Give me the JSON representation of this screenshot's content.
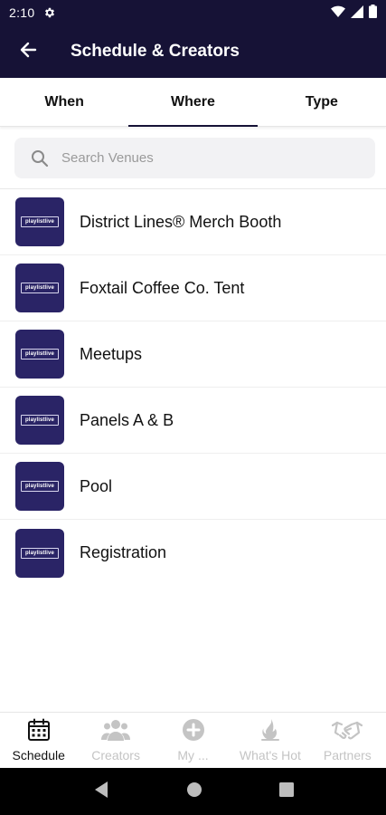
{
  "status_bar": {
    "time": "2:10"
  },
  "app_bar": {
    "title": "Schedule & Creators"
  },
  "tabs": [
    {
      "label": "When",
      "active": false
    },
    {
      "label": "Where",
      "active": true
    },
    {
      "label": "Type",
      "active": false
    }
  ],
  "search": {
    "placeholder": "Search Venues",
    "value": ""
  },
  "venue_logo_text": "playlistlive",
  "venues": [
    {
      "label": "District Lines® Merch Booth"
    },
    {
      "label": "Foxtail Coffee Co. Tent"
    },
    {
      "label": "Meetups"
    },
    {
      "label": "Panels A & B"
    },
    {
      "label": "Pool"
    },
    {
      "label": "Registration"
    }
  ],
  "bottom_nav": [
    {
      "label": "Schedule",
      "icon": "calendar-icon",
      "active": true
    },
    {
      "label": "Creators",
      "icon": "people-icon",
      "active": false
    },
    {
      "label": "My ...",
      "icon": "plus-circle-icon",
      "active": false
    },
    {
      "label": "What's Hot",
      "icon": "flame-icon",
      "active": false
    },
    {
      "label": "Partners",
      "icon": "handshake-icon",
      "active": false
    }
  ],
  "colors": {
    "header": "#161236",
    "logo_bg": "#2a2466",
    "inactive_nav": "#c4c4c4"
  }
}
